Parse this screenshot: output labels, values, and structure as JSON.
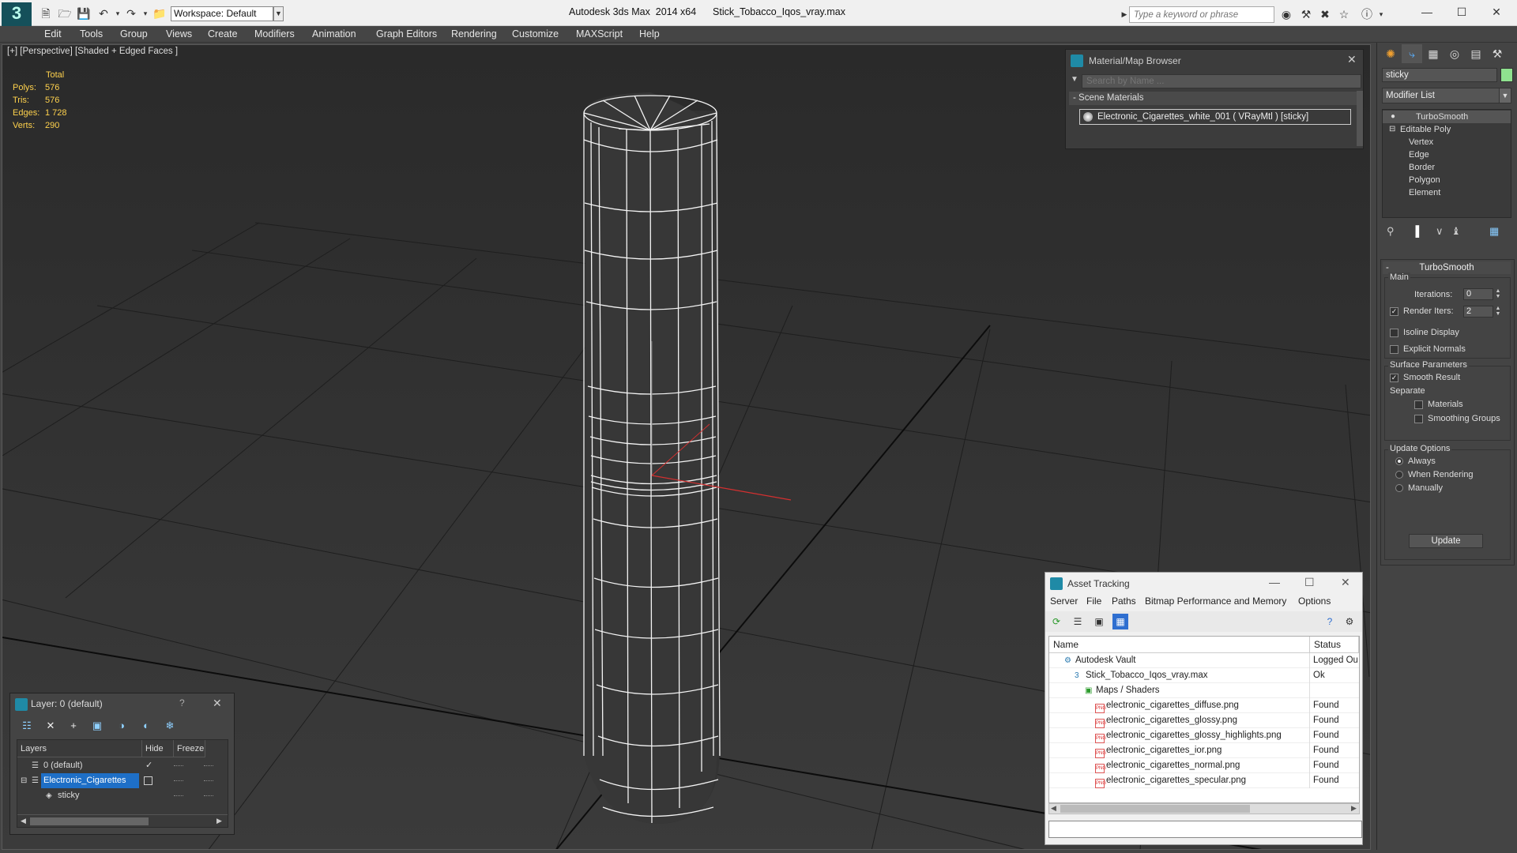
{
  "title_bar": {
    "app_logo": "3",
    "workspace_label": "Workspace: Default",
    "window_title": "Autodesk 3ds Max  2014 x64      Stick_Tobacco_Iqos_vray.max",
    "search_placeholder": "Type a keyword or phrase"
  },
  "menu": [
    "Edit",
    "Tools",
    "Group",
    "Views",
    "Create",
    "Modifiers",
    "Animation",
    "Graph Editors",
    "Rendering",
    "Customize",
    "MAXScript",
    "Help"
  ],
  "viewport": {
    "label": "[+] [Perspective] [Shaded + Edged Faces ]",
    "stats_header": "Total",
    "stats": [
      {
        "key": "Polys:",
        "value": "576"
      },
      {
        "key": "Tris:",
        "value": "576"
      },
      {
        "key": "Edges:",
        "value": "1 728"
      },
      {
        "key": "Verts:",
        "value": "290"
      }
    ]
  },
  "material_browser": {
    "title": "Material/Map Browser",
    "search_placeholder": "Search by Name ...",
    "section": "- Scene Materials",
    "item": "Electronic_Cigarettes_white_001  ( VRayMtl )  [sticky]"
  },
  "command_panel": {
    "object_name": "sticky",
    "object_color": "#8fe28f",
    "modifier_list": "Modifier List",
    "stack": [
      "TurboSmooth",
      "Editable Poly",
      "Vertex",
      "Edge",
      "Border",
      "Polygon",
      "Element"
    ],
    "rollout_title": "TurboSmooth",
    "main_group": "Main",
    "iterations_label": "Iterations:",
    "iterations_value": "0",
    "render_iters_label": "Render Iters:",
    "render_iters_value": "2",
    "render_iters_checked": true,
    "isoline_label": "Isoline Display",
    "explicit_normals_label": "Explicit Normals",
    "surface_group": "Surface Parameters",
    "smooth_result_label": "Smooth Result",
    "separate_label": "Separate",
    "materials_label": "Materials",
    "smoothing_groups_label": "Smoothing Groups",
    "update_group": "Update Options",
    "always_label": "Always",
    "when_rendering_label": "When Rendering",
    "manually_label": "Manually",
    "update_button": "Update"
  },
  "asset_tracking": {
    "title": "Asset Tracking",
    "menu": [
      "Server",
      "File",
      "Paths",
      "Bitmap Performance and Memory",
      "Options"
    ],
    "col_name": "Name",
    "col_status": "Status",
    "rows": [
      {
        "name": "Autodesk Vault",
        "status": "Logged Ou",
        "indent": 1,
        "icon": "vault"
      },
      {
        "name": "Stick_Tobacco_Iqos_vray.max",
        "status": "Ok",
        "indent": 2,
        "icon": "max"
      },
      {
        "name": "Maps / Shaders",
        "status": "",
        "indent": 3,
        "icon": "maps"
      },
      {
        "name": "electronic_cigarettes_diffuse.png",
        "status": "Found",
        "indent": 4,
        "icon": "png"
      },
      {
        "name": "electronic_cigarettes_glossy.png",
        "status": "Found",
        "indent": 4,
        "icon": "png"
      },
      {
        "name": "electronic_cigarettes_glossy_highlights.png",
        "status": "Found",
        "indent": 4,
        "icon": "png"
      },
      {
        "name": "electronic_cigarettes_ior.png",
        "status": "Found",
        "indent": 4,
        "icon": "png"
      },
      {
        "name": "electronic_cigarettes_normal.png",
        "status": "Found",
        "indent": 4,
        "icon": "png"
      },
      {
        "name": "electronic_cigarettes_specular.png",
        "status": "Found",
        "indent": 4,
        "icon": "png"
      }
    ]
  },
  "layer_manager": {
    "title": "Layer: 0 (default)",
    "help": "?",
    "col_layers": "Layers",
    "col_hide": "Hide",
    "col_freeze": "Freeze",
    "rows": [
      {
        "name": "0 (default)"
      },
      {
        "name": "Electronic_Cigarettes"
      },
      {
        "name": "sticky"
      }
    ]
  }
}
